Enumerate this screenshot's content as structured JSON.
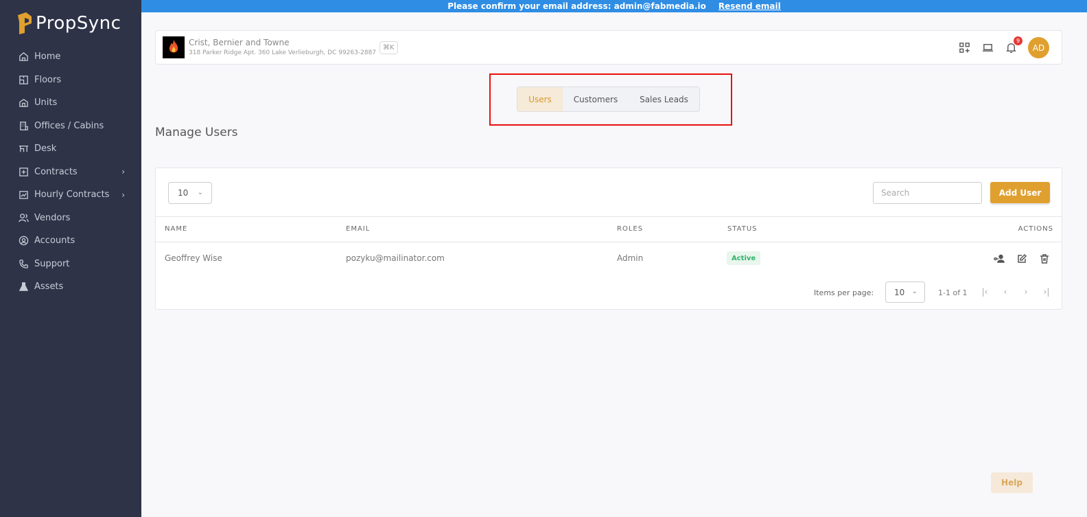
{
  "app": {
    "name": "PropSync",
    "brand_color": "#e0a02f",
    "sidebar_color": "#2e3348"
  },
  "sidebar": {
    "items": [
      {
        "label": "Home",
        "icon": "home-icon"
      },
      {
        "label": "Floors",
        "icon": "floor-plan-icon"
      },
      {
        "label": "Units",
        "icon": "building-icon"
      },
      {
        "label": "Offices / Cabins",
        "icon": "office-icon"
      },
      {
        "label": "Desk",
        "icon": "desk-icon"
      },
      {
        "label": "Contracts",
        "icon": "contract-icon",
        "expandable": true
      },
      {
        "label": "Hourly Contracts",
        "icon": "chart-icon",
        "expandable": true
      },
      {
        "label": "Vendors",
        "icon": "users-icon"
      },
      {
        "label": "Accounts",
        "icon": "account-icon"
      },
      {
        "label": "Support",
        "icon": "phone-icon"
      },
      {
        "label": "Assets",
        "icon": "flask-icon"
      }
    ]
  },
  "banner": {
    "message": "Please confirm your email address: admin@fabmedia.io",
    "link": "Resend email",
    "color": "#2f8de4"
  },
  "header": {
    "org_name": "Crist, Bernier and Towne",
    "org_address": "318 Parker Ridge Apt. 360 Lake Verlieburgh, DC 99263-2887",
    "shortcut": "⌘K",
    "notification_count": "9",
    "avatar_initials": "AD"
  },
  "tabs": [
    {
      "label": "Users",
      "active": true
    },
    {
      "label": "Customers",
      "active": false
    },
    {
      "label": "Sales Leads",
      "active": false
    }
  ],
  "page_title": "Manage Users",
  "table": {
    "page_size": "10",
    "search_placeholder": "Search",
    "add_button": "Add User",
    "columns": {
      "name": "NAME",
      "email": "EMAIL",
      "roles": "ROLES",
      "status": "STATUS",
      "actions": "ACTIONS"
    },
    "rows": [
      {
        "name": "Geoffrey Wise",
        "email": "pozyku@mailinator.com",
        "roles": "Admin",
        "status": "Active"
      }
    ]
  },
  "pagination": {
    "items_per_page_label": "Items per page:",
    "items_per_page": "10",
    "range": "1-1 of 1"
  },
  "help_button": "Help"
}
